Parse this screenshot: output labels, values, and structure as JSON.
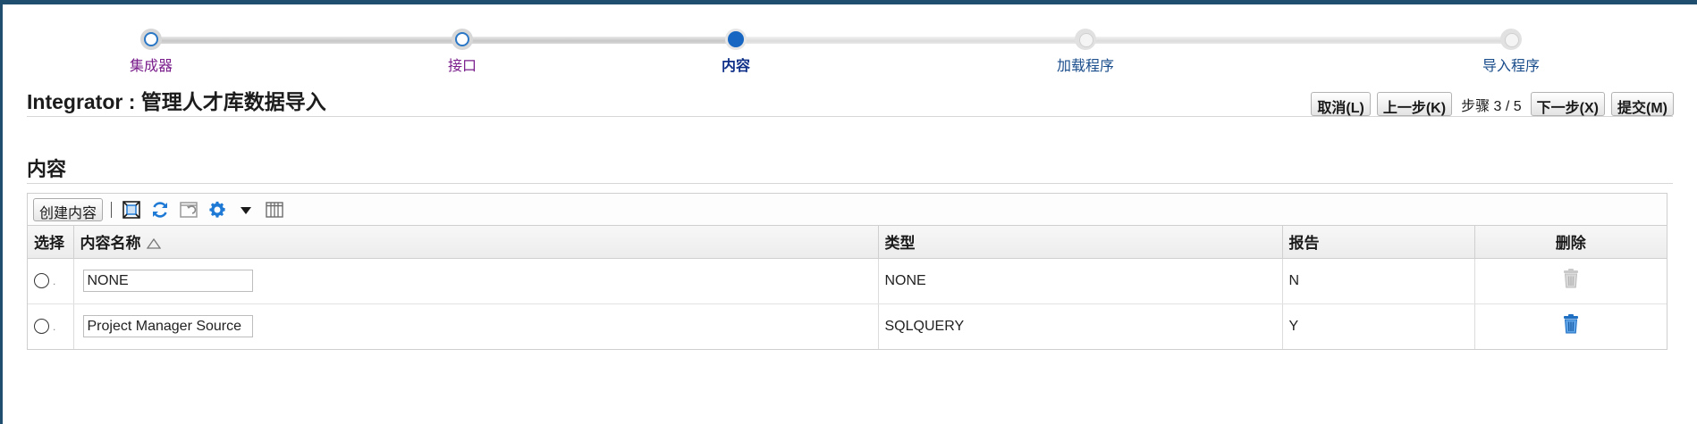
{
  "train": {
    "steps": [
      {
        "label": "集成器",
        "state": "visited"
      },
      {
        "label": "接口",
        "state": "visited"
      },
      {
        "label": "内容",
        "state": "current"
      },
      {
        "label": "加载程序",
        "state": "pending"
      },
      {
        "label": "导入程序",
        "state": "pending"
      }
    ]
  },
  "page": {
    "title": "Integrator : 管理人才库数据导入"
  },
  "actions": {
    "cancel": "取消(L)",
    "back": "上一步(K)",
    "step_indicator": "步骤 3 / 5",
    "next": "下一步(X)",
    "submit": "提交(M)"
  },
  "section": {
    "title": "内容"
  },
  "toolbar": {
    "create_label": "创建内容",
    "icons": [
      "detach-icon",
      "refresh-icon",
      "restore-icon",
      "settings-gear-icon",
      "dropdown-arrow-icon",
      "columns-icon"
    ]
  },
  "table": {
    "headers": {
      "select": "选择",
      "name": "内容名称",
      "type": "类型",
      "report": "报告",
      "delete": "删除"
    },
    "rows": [
      {
        "name": "NONE",
        "type": "NONE",
        "report": "N",
        "delete_enabled": false
      },
      {
        "name": "Project Manager Source",
        "type": "SQLQUERY",
        "report": "Y",
        "delete_enabled": true
      }
    ]
  },
  "colors": {
    "frame": "#1f4e6e",
    "visited_label": "#7a1d8c",
    "current_dot": "#1766c2",
    "icon_blue": "#1f7ad6"
  }
}
